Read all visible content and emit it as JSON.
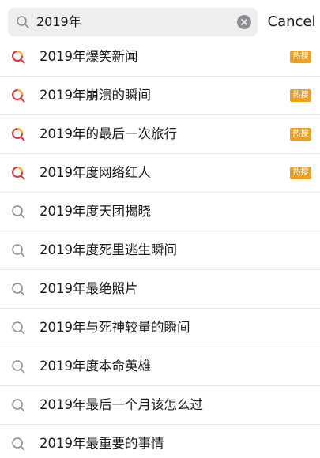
{
  "search": {
    "value": "2019年",
    "cancel_label": "Cancel"
  },
  "colors": {
    "hot_badge": "#f0a020",
    "hot_icon_red": "#e0303a",
    "hot_icon_yellow": "#f0b020",
    "search_gray": "#8e8e93"
  },
  "suggestions": [
    {
      "label": "2019年爆笑新闻",
      "hot": true,
      "badge": "热搜",
      "icon": "hot-search-icon"
    },
    {
      "label": "2019年崩溃的瞬间",
      "hot": true,
      "badge": "热搜",
      "icon": "hot-search-icon"
    },
    {
      "label": "2019年的最后一次旅行",
      "hot": true,
      "badge": "热搜",
      "icon": "hot-search-icon"
    },
    {
      "label": "2019年度网络红人",
      "hot": true,
      "badge": "热搜",
      "icon": "hot-search-icon"
    },
    {
      "label": "2019年度天团揭晓",
      "hot": false,
      "icon": "search-icon"
    },
    {
      "label": "2019年度死里逃生瞬间",
      "hot": false,
      "icon": "search-icon"
    },
    {
      "label": "2019年最绝照片",
      "hot": false,
      "icon": "search-icon"
    },
    {
      "label": "2019年与死神较量的瞬间",
      "hot": false,
      "icon": "search-icon"
    },
    {
      "label": "2019年度本命英雄",
      "hot": false,
      "icon": "search-icon"
    },
    {
      "label": "2019年最后一个月该怎么过",
      "hot": false,
      "icon": "search-icon"
    },
    {
      "label": "2019年最重要的事情",
      "hot": false,
      "icon": "search-icon"
    }
  ]
}
